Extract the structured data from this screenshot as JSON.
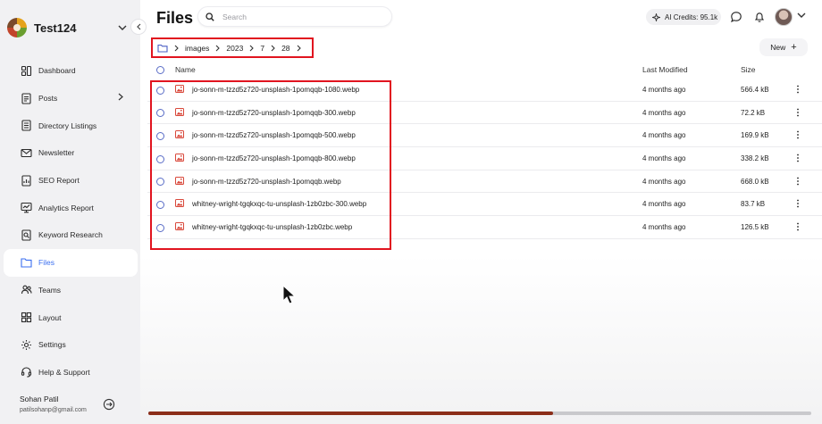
{
  "workspace": {
    "name": "Test124"
  },
  "sidebar": {
    "items": [
      {
        "label": "Dashboard",
        "icon": "dashboard-icon"
      },
      {
        "label": "Posts",
        "icon": "posts-icon",
        "has_submenu": true
      },
      {
        "label": "Directory Listings",
        "icon": "directory-icon"
      },
      {
        "label": "Newsletter",
        "icon": "mail-icon"
      },
      {
        "label": "SEO Report",
        "icon": "seo-icon"
      },
      {
        "label": "Analytics Report",
        "icon": "analytics-icon"
      },
      {
        "label": "Keyword Research",
        "icon": "keyword-icon"
      },
      {
        "label": "Files",
        "icon": "folder-icon",
        "active": true
      },
      {
        "label": "Teams",
        "icon": "teams-icon"
      },
      {
        "label": "Layout",
        "icon": "layout-icon"
      },
      {
        "label": "Settings",
        "icon": "settings-icon"
      },
      {
        "label": "Help & Support",
        "icon": "headset-icon"
      }
    ]
  },
  "user": {
    "name": "Sohan Patil",
    "email": "patilsohanp@gmail.com"
  },
  "header": {
    "title": "Files",
    "search_placeholder": "Search",
    "credits": "AI Credits: 95.1k"
  },
  "breadcrumb": {
    "items": [
      "images",
      "2023",
      "7",
      "28"
    ]
  },
  "actions": {
    "new_label": "New"
  },
  "table": {
    "headers": {
      "name": "Name",
      "modified": "Last Modified",
      "size": "Size"
    },
    "rows": [
      {
        "name": "jo-sonn-m-tzzd5z720-unsplash-1pomqqb-1080.webp",
        "modified": "4 months ago",
        "size": "566.4 kB"
      },
      {
        "name": "jo-sonn-m-tzzd5z720-unsplash-1pomqqb-300.webp",
        "modified": "4 months ago",
        "size": "72.2 kB"
      },
      {
        "name": "jo-sonn-m-tzzd5z720-unsplash-1pomqqb-500.webp",
        "modified": "4 months ago",
        "size": "169.9 kB"
      },
      {
        "name": "jo-sonn-m-tzzd5z720-unsplash-1pomqqb-800.webp",
        "modified": "4 months ago",
        "size": "338.2 kB"
      },
      {
        "name": "jo-sonn-m-tzzd5z720-unsplash-1pomqqb.webp",
        "modified": "4 months ago",
        "size": "668.0 kB"
      },
      {
        "name": "whitney-wright-tgqkxqc-tu-unsplash-1zb0zbc-300.webp",
        "modified": "4 months ago",
        "size": "83.7 kB"
      },
      {
        "name": "whitney-wright-tgqkxqc-tu-unsplash-1zb0zbc.webp",
        "modified": "4 months ago",
        "size": "126.5 kB"
      }
    ]
  },
  "video_progress": {
    "fraction": 0.61
  },
  "colors": {
    "accent": "#3b6ff0",
    "highlight": "#e1141f",
    "file_icon": "#d9483b",
    "progress": "#8b2e1a"
  }
}
